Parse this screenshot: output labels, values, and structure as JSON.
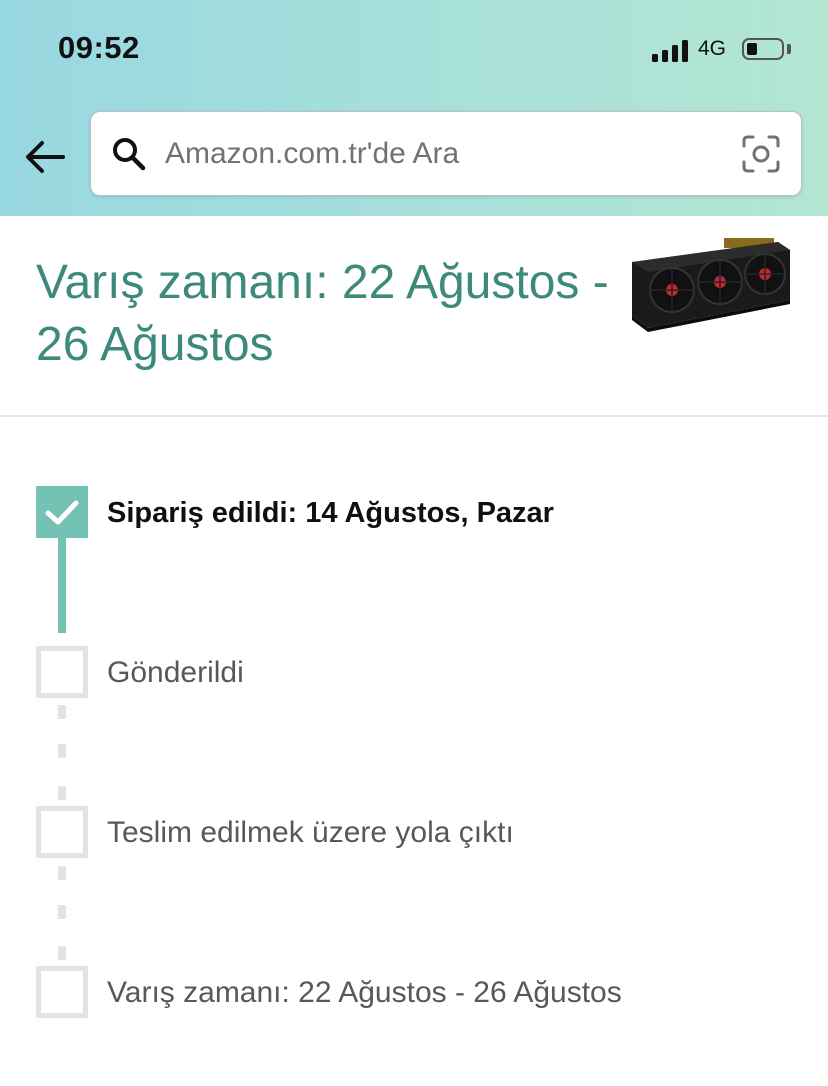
{
  "status_bar": {
    "time": "09:52",
    "network": "4G",
    "battery_level": 0.3,
    "signal_bars": 4
  },
  "header": {
    "back_icon": "arrow-left-icon",
    "search": {
      "placeholder": "Amazon.com.tr'de Ara",
      "value": "",
      "icon": "search-icon",
      "camera_icon": "camera-scan-icon"
    }
  },
  "order": {
    "arrival_title": "Varış zamanı: 22 Ağustos - 26 Ağustos",
    "product_image": "graphics-card-image"
  },
  "tracking": {
    "steps": [
      {
        "label": "Sipariş edildi: 14 Ağustos, Pazar",
        "completed": true
      },
      {
        "label": "Gönderildi",
        "completed": false
      },
      {
        "label": "Teslim edilmek üzere yola çıktı",
        "completed": false
      },
      {
        "label": "Varış zamanı: 22 Ağustos - 26 Ağustos",
        "completed": false
      }
    ]
  },
  "colors": {
    "accent": "#3d8a7d",
    "progress": "#74c2b3",
    "pending": "#e3e3e3"
  }
}
